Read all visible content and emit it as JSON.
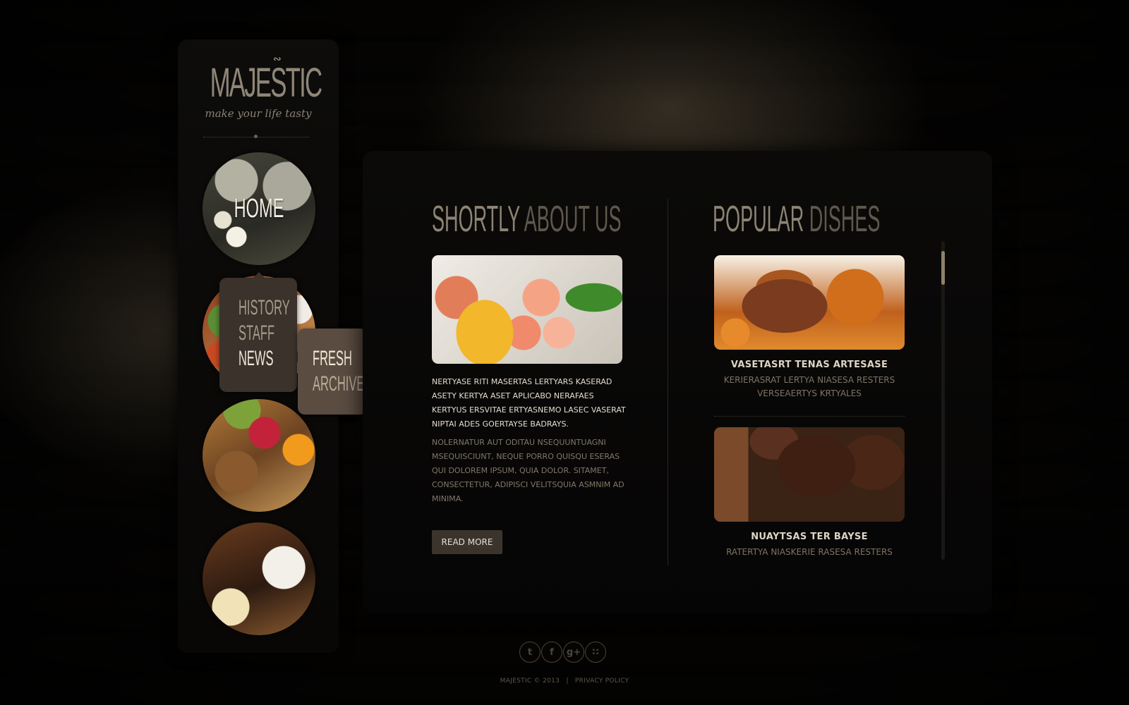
{
  "logo": {
    "title": "MAJESTIC",
    "tagline": "make your life tasty"
  },
  "nav": {
    "home": "HOME",
    "submenu": [
      "HISTORY",
      "STAFF",
      "NEWS"
    ],
    "news_submenu": [
      "FRESH",
      "ARCHIVE"
    ]
  },
  "about": {
    "heading_part1": "SHORTLY",
    "heading_part2": "ABOUT US",
    "paragraph1": "NERTYASE RITI MASERTAS LERTYARS KASERAD ASETY KERTYA ASET APLICABO NERAFAES KERTYUS ERSVITAE ERTYASNEMO LASEC VASERAT NIPTAI ADES GOERTAYSE BADRAYS.",
    "paragraph2": "NOLERNATUR AUT ODITAU NSEQUUNTUAGNI MSEQUISCIUNT, NEQUE PORRO QUISQU ESERAS QUI DOLOREM IPSUM, QUIA DOLOR. SITAMET, CONSECTETUR, ADIPISCI VELITSQUIA ASMNIM AD MINIMA.",
    "read_more": "READ MORE"
  },
  "dishes": {
    "heading_part1": "POPULAR",
    "heading_part2": "DISHES",
    "items": [
      {
        "title": "VASETASRT TENAS ARTESASE",
        "desc": "KERIERASRAT LERTYA NIASESA RESTERS VERSEAERTYS KRTYALES"
      },
      {
        "title": "NUAYTSAS TER BAYSE",
        "desc": "RATERTYA NIASKERIE RASESA RESTERS"
      }
    ]
  },
  "footer": {
    "copyright": "MAJESTIC © 2013",
    "separator": "|",
    "privacy": "PRIVACY POLICY",
    "social_icons": [
      "twitter-icon",
      "facebook-icon",
      "google-plus-icon",
      "rss-icon"
    ]
  },
  "colors": {
    "accent": "#8c8373",
    "submenu_bg": "#3a322b",
    "submenu2_bg": "#5a4c40",
    "panel_bg": "#0b0a09"
  }
}
